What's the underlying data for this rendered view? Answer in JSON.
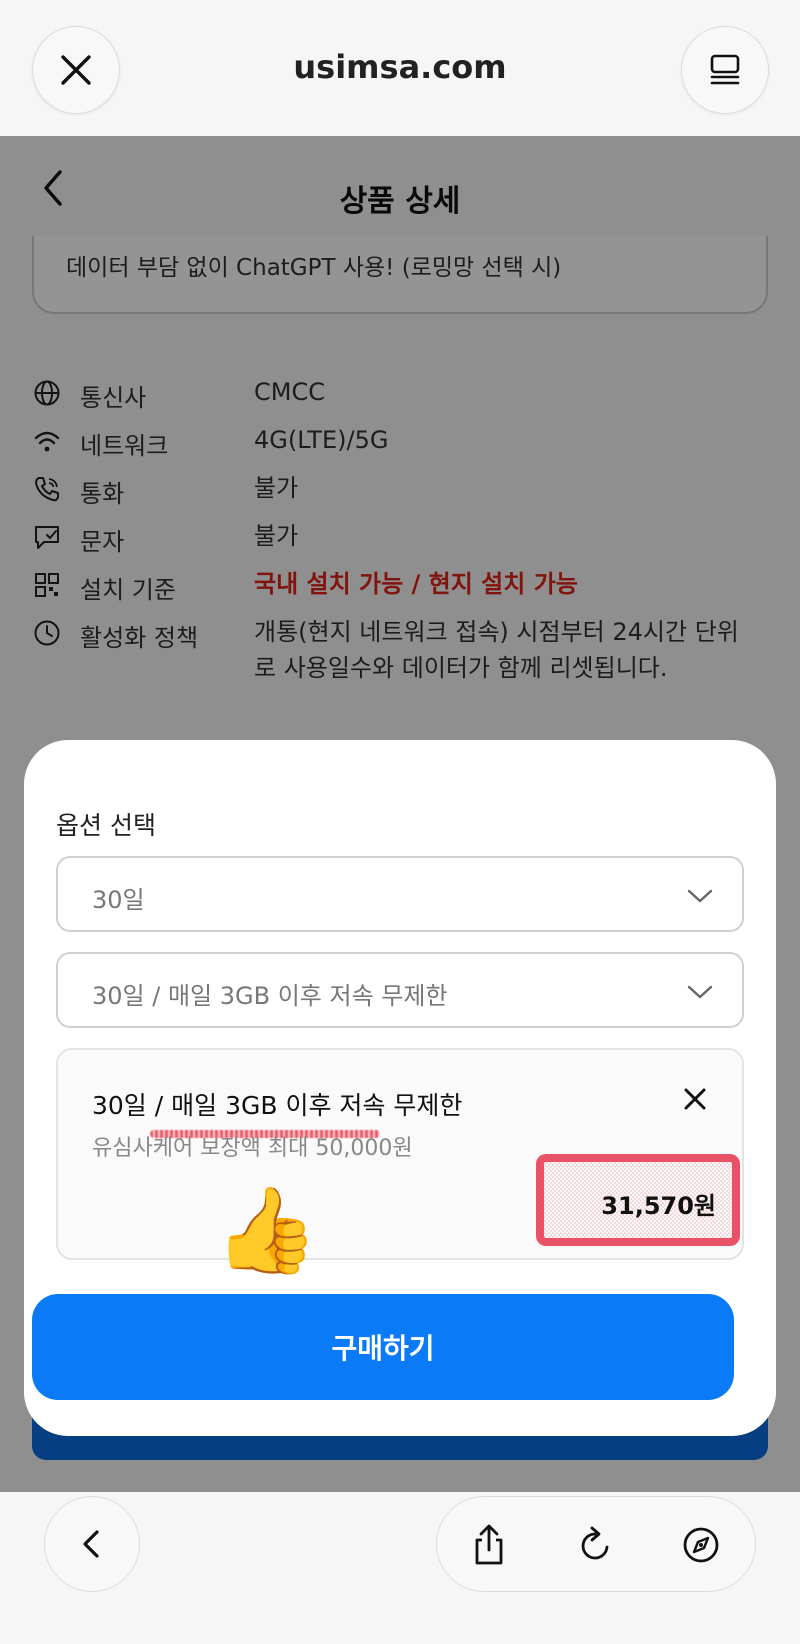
{
  "browser": {
    "url": "usimsa.com",
    "close_icon": "close-icon",
    "reader_icon": "reader-icon"
  },
  "page": {
    "title": "상품 상세",
    "promo": "데이터 부담 없이 ChatGPT 사용! (로밍망 선택 시)",
    "specs": [
      {
        "icon": "globe-icon",
        "label": "통신사",
        "value": "CMCC"
      },
      {
        "icon": "wifi-icon",
        "label": "네트워크",
        "value": "4G(LTE)/5G"
      },
      {
        "icon": "phone-icon",
        "label": "통화",
        "value": "불가"
      },
      {
        "icon": "message-icon",
        "label": "문자",
        "value": "불가"
      },
      {
        "icon": "qr-icon",
        "label": "설치 기준",
        "value": "국내 설치 가능 / 현지 설치 가능"
      },
      {
        "icon": "clock-icon",
        "label": "활성화 정책",
        "value": "개통(현지 네트워크 접속) 시점부터 24시간 단위로 사용일수와 데이터가 함께 리셋됩니다."
      }
    ],
    "highlight_color": "#e0241b"
  },
  "sheet": {
    "title": "옵션 선택",
    "select_days": "30일",
    "select_plan": "30일 / 매일 3GB 이후 저속 무제한",
    "selected": {
      "title": "30일 / 매일 3GB 이후 저속 무제한",
      "subtitle": "유심사케어 보장액 최대 50,000원",
      "price": "31,570원"
    },
    "thumb_emoji": "👍",
    "buy_label": "구매하기",
    "buy_color": "#0a7af7"
  },
  "toolbar": {
    "back_icon": "back-icon",
    "share_icon": "share-icon",
    "reload_icon": "reload-icon",
    "compass_icon": "compass-icon"
  }
}
